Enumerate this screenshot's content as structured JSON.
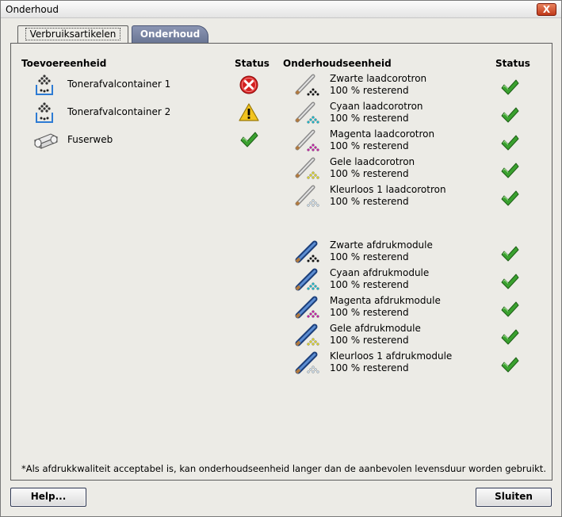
{
  "window": {
    "title": "Onderhoud",
    "close_label": "X"
  },
  "tabs": [
    {
      "label": "Verbruiksartikelen",
      "active": true
    },
    {
      "label": "Onderhoud",
      "active": false
    }
  ],
  "left": {
    "header": "Toevoereenheid",
    "status_header": "Status",
    "items": [
      {
        "label": "Tonerafvalcontainer 1",
        "icon": "toner-waste-icon",
        "status": "error"
      },
      {
        "label": "Tonerafvalcontainer 2",
        "icon": "toner-waste-icon",
        "status": "warning"
      },
      {
        "label": "Fuserweb",
        "icon": "fuser-web-icon",
        "status": "ok"
      }
    ]
  },
  "right": {
    "header": "Onderhoudseenheid",
    "status_header": "Status",
    "corotrons": [
      {
        "name": "Zwarte laadcorotron",
        "remaining": "100 % resterend",
        "color": "#111111",
        "status": "ok"
      },
      {
        "name": "Cyaan laadcorotron",
        "remaining": "100 % resterend",
        "color": "#19b5c8",
        "status": "ok"
      },
      {
        "name": "Magenta laadcorotron",
        "remaining": "100 % resterend",
        "color": "#c21fa4",
        "status": "ok"
      },
      {
        "name": "Gele laadcorotron",
        "remaining": "100 % resterend",
        "color": "#d8cf2a",
        "status": "ok"
      },
      {
        "name": "Kleurloos 1 laadcorotron",
        "remaining": "100 % resterend",
        "color": "#c8d8e6",
        "status": "ok"
      }
    ],
    "modules": [
      {
        "name": "Zwarte afdrukmodule",
        "remaining": "100 % resterend",
        "color": "#111111",
        "status": "ok"
      },
      {
        "name": "Cyaan afdrukmodule",
        "remaining": "100 % resterend",
        "color": "#19b5c8",
        "status": "ok"
      },
      {
        "name": "Magenta afdrukmodule",
        "remaining": "100 % resterend",
        "color": "#c21fa4",
        "status": "ok"
      },
      {
        "name": "Gele afdrukmodule",
        "remaining": "100 % resterend",
        "color": "#d8cf2a",
        "status": "ok"
      },
      {
        "name": "Kleurloos 1 afdrukmodule",
        "remaining": "100 % resterend",
        "color": "#c8d8e6",
        "status": "ok"
      }
    ]
  },
  "footnote": "*Als afdrukkwaliteit acceptabel is, kan onderhoudseenheid langer dan de aanbevolen levensduur worden gebruikt.",
  "buttons": {
    "help": "Help...",
    "close": "Sluiten"
  },
  "colors": {
    "tab_inactive": "#7a84a3",
    "error": "#d42020",
    "warning": "#f2c31e",
    "ok": "#3aa12f"
  }
}
